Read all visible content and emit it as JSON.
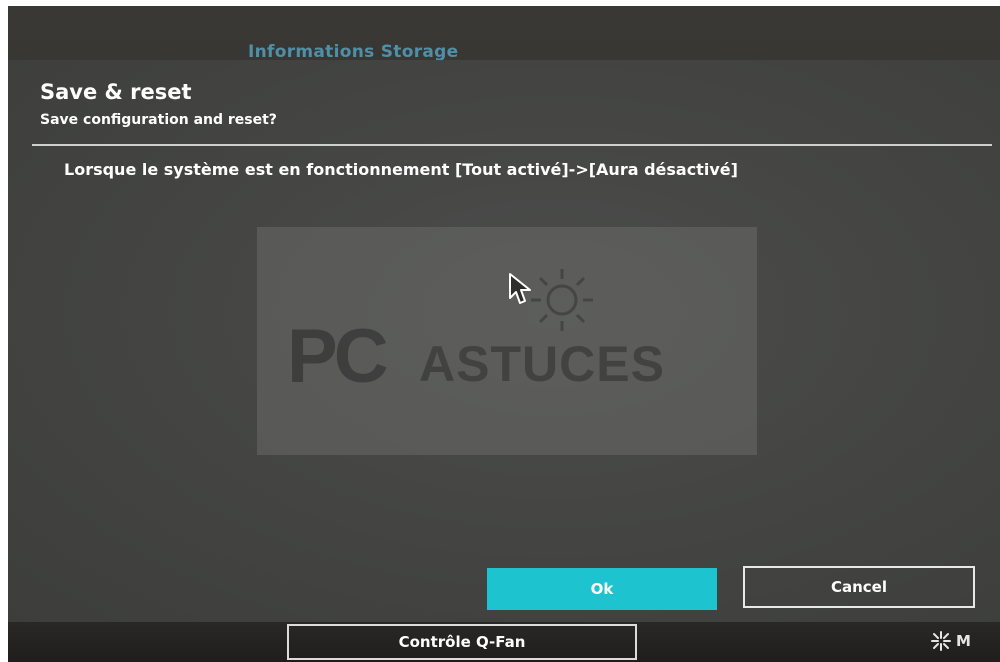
{
  "background_tab": {
    "label": "Informations Storage"
  },
  "dialog": {
    "title": "Save & reset",
    "subtitle": "Save configuration and reset?",
    "message": "Lorsque le système est en fonctionnement [Tout activé]->[Aura désactivé]",
    "ok_label": "Ok",
    "cancel_label": "Cancel"
  },
  "watermark": {
    "text_pc": "PC",
    "text_astuces": "ASTUCES"
  },
  "bottom_bar": {
    "qfan_label": "Contrôle Q-Fan",
    "right_label": "M",
    "right_icon": "fan-icon"
  },
  "colors": {
    "accent": "#1ec3d0",
    "dialog_bg": "#454644",
    "text": "#ffffff",
    "tab_text": "#4f8fa8"
  }
}
